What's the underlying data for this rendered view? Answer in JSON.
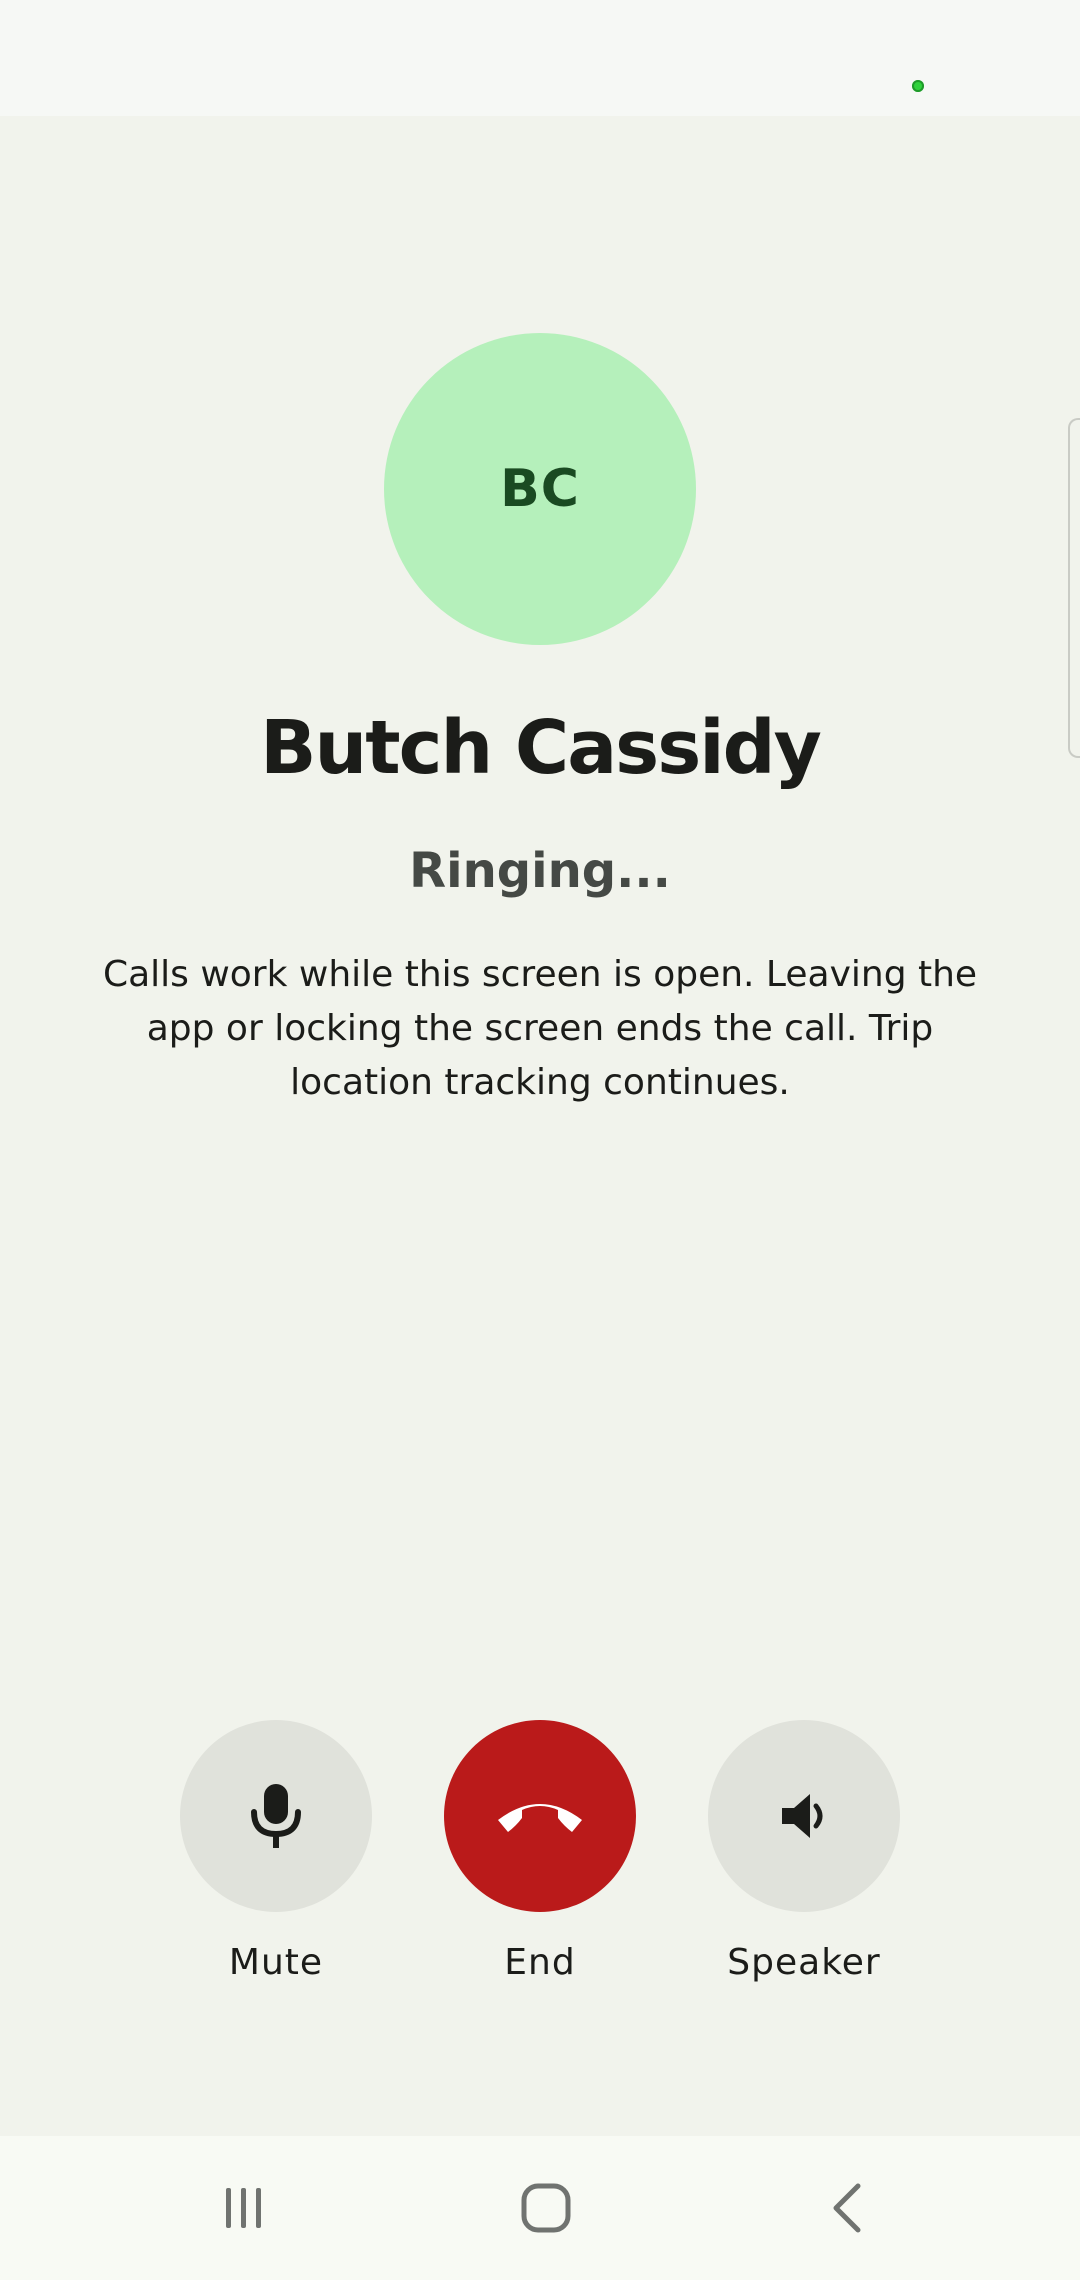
{
  "caller": {
    "initials": "BC",
    "name": "Butch Cassidy",
    "status": "Ringing..."
  },
  "notice": "Calls work while this screen is open. Leaving the app or locking the screen ends the call. Trip location tracking continues.",
  "controls": {
    "mute": {
      "label": "Mute",
      "icon": "microphone-icon"
    },
    "end": {
      "label": "End",
      "icon": "hang-up-icon"
    },
    "speaker": {
      "label": "Speaker",
      "icon": "speaker-icon"
    }
  },
  "navigation": {
    "recents_icon": "recents-icon",
    "home_icon": "home-icon",
    "back_icon": "back-icon"
  },
  "colors": {
    "background": "#f1f3ec",
    "avatar": "#b5f0bb",
    "avatar_text": "#1a4a22",
    "end_button": "#ba1a1a",
    "control_button": "#e0e2db"
  }
}
